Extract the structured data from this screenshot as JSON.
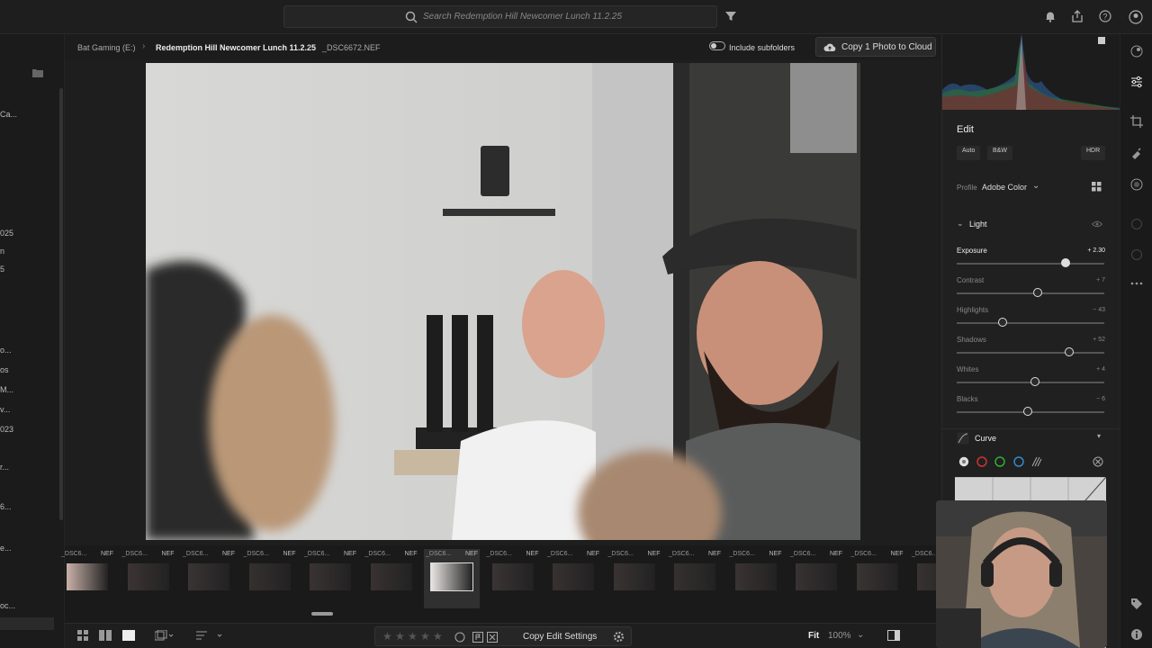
{
  "search": {
    "placeholder": "Search Redemption Hill Newcomer Lunch 11.2.25"
  },
  "breadcrumb": {
    "root": "Bat Gaming (E:)",
    "album": "Redemption Hill Newcomer Lunch 11.2.25",
    "file": "_DSC6672.NEF"
  },
  "include_subfolders": "Include subfolders",
  "copy_to_cloud": "Copy 1 Photo to Cloud",
  "left_sidebar_fragments": [
    "Ca...",
    "025",
    "n",
    "5",
    "o...",
    "os",
    "M...",
    "v...",
    "023",
    "r...",
    "6...",
    "e...",
    "oc...",
    "o..."
  ],
  "filmstrip": {
    "items": [
      {
        "name": "_DSC6...",
        "ext": "NEF"
      },
      {
        "name": "_DSC6...",
        "ext": "NEF"
      },
      {
        "name": "_DSC6...",
        "ext": "NEF"
      },
      {
        "name": "_DSC6...",
        "ext": "NEF"
      },
      {
        "name": "_DSC6...",
        "ext": "NEF"
      },
      {
        "name": "_DSC6...",
        "ext": "NEF"
      },
      {
        "name": "_DSC6...",
        "ext": "NEF"
      },
      {
        "name": "_DSC6...",
        "ext": "NEF"
      },
      {
        "name": "_DSC6...",
        "ext": "NEF"
      },
      {
        "name": "_DSC6...",
        "ext": "NEF"
      },
      {
        "name": "_DSC6...",
        "ext": "NEF"
      },
      {
        "name": "_DSC6...",
        "ext": "NEF"
      },
      {
        "name": "_DSC6...",
        "ext": "NEF"
      },
      {
        "name": "_DSC6...",
        "ext": "NEF"
      },
      {
        "name": "_DSC6...",
        "ext": "NEF"
      }
    ],
    "selected_index": 6
  },
  "bottombar": {
    "copy_edit_settings": "Copy Edit Settings",
    "fit": "Fit",
    "zoom": "100%"
  },
  "edit_panel": {
    "title": "Edit",
    "auto": "Auto",
    "bw": "B&W",
    "hdr": "HDR",
    "profile_label": "Profile",
    "profile_value": "Adobe Color",
    "light_section": "Light",
    "curve_section": "Curve",
    "sliders": [
      {
        "label": "Exposure",
        "value": "+ 2.30",
        "position": 0.74,
        "active": true
      },
      {
        "label": "Contrast",
        "value": "+ 7",
        "position": 0.55,
        "active": false
      },
      {
        "label": "Highlights",
        "value": "− 43",
        "position": 0.31,
        "active": false
      },
      {
        "label": "Shadows",
        "value": "+ 52",
        "position": 0.76,
        "active": false
      },
      {
        "label": "Whites",
        "value": "+ 4",
        "position": 0.53,
        "active": false
      },
      {
        "label": "Blacks",
        "value": "− 6",
        "position": 0.48,
        "active": false
      }
    ]
  },
  "colors": {
    "accent": "#e0e0e0",
    "panel_bg": "#202020",
    "app_bg": "#1a1a1a"
  }
}
